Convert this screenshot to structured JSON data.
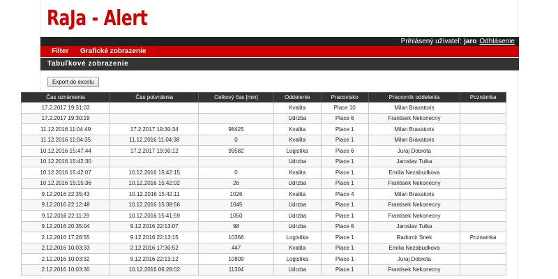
{
  "app": {
    "title": "RaJa - Alert"
  },
  "userbar": {
    "label": "Prihlásený užívateľ:",
    "username": "jaro",
    "logout_label": "Odhlásenie"
  },
  "menu": {
    "items": [
      {
        "label": "Filter"
      },
      {
        "label": "Grafické zobrazenie"
      }
    ]
  },
  "section": {
    "title": "Tabuľkové zobrazenie"
  },
  "toolbar": {
    "export_label": "Export do excelu"
  },
  "table": {
    "headers": [
      "Čas oznámenia",
      "Čas potvrdenia",
      "Celkový čas [min]",
      "Oddelenie",
      "Pracovisko",
      "Pracovník oddelenia",
      "Poznámka"
    ],
    "rows": [
      [
        "17.2.2017 19:31:03",
        "",
        "",
        "Kvalita",
        "Place 10",
        "Milan Braxatoris",
        ""
      ],
      [
        "17.2.2017 19:30:19",
        "",
        "",
        "Udrzba",
        "Place 6",
        "Frantisek Nekonecny",
        ""
      ],
      [
        "11.12.2016 11:04:49",
        "17.2.2017 19:30:34",
        "98425",
        "Kvalita",
        "Place 1",
        "Milan Braxatoris",
        ""
      ],
      [
        "11.12.2016 11:04:35",
        "11.12.2016 11:04:38",
        "0",
        "Kvalita",
        "Place 1",
        "Milan Braxatoris",
        ""
      ],
      [
        "10.12.2016 15:47:44",
        "17.2.2017 19:30:12",
        "99582",
        "Logistika",
        "Place 6",
        "Juraj Dobrota",
        ""
      ],
      [
        "10.12.2016 15:42:30",
        "",
        "",
        "Udrzba",
        "Place 1",
        "Jaroslav Tulka",
        ""
      ],
      [
        "10.12.2016 15:42:07",
        "10.12.2016 15:42:15",
        "0",
        "Kvalita",
        "Place 1",
        "Emilia Nezabudkova",
        ""
      ],
      [
        "10.12.2016 15:15:36",
        "10.12.2016 15:42:02",
        "26",
        "Udrzba",
        "Place 1",
        "Frantisek Nekonecny",
        ""
      ],
      [
        "9.12.2016 22:35:43",
        "10.12.2016 15:42:11",
        "1026",
        "Kvalita",
        "Place 4",
        "Milan Braxatoris",
        ""
      ],
      [
        "9.12.2016 22:12:48",
        "10.12.2016 15:38:56",
        "1045",
        "Udrzba",
        "Place 1",
        "Frantisek Nekonecny",
        ""
      ],
      [
        "9.12.2016 22:11:29",
        "10.12.2016 15:41:59",
        "1050",
        "Udrzba",
        "Place 1",
        "Frantisek Nekonecny",
        ""
      ],
      [
        "9.12.2016 20:35:04",
        "9.12.2016 22:13:07",
        "98",
        "Udrzba",
        "Place 6",
        "Jaroslav Tulka",
        ""
      ],
      [
        "2.12.2016 17:26:55",
        "9.12.2016 22:13:15",
        "10366",
        "Logistika",
        "Place 1",
        "Radomir Snek",
        "Poznamka"
      ],
      [
        "2.12.2016 10:03:33",
        "2.12.2016 17:30:52",
        "447",
        "Kvalita",
        "Place 1",
        "Emilia Nezabudkova",
        ""
      ],
      [
        "2.12.2016 10:03:32",
        "9.12.2016 22:13:12",
        "10809",
        "Logistika",
        "Place 1",
        "Juraj Dobrota",
        ""
      ],
      [
        "2.12.2016 10:03:30",
        "10.12.2016 06:28:02",
        "11304",
        "Udrzba",
        "Place 1",
        "Frantisek Nekonecny",
        ""
      ]
    ]
  }
}
